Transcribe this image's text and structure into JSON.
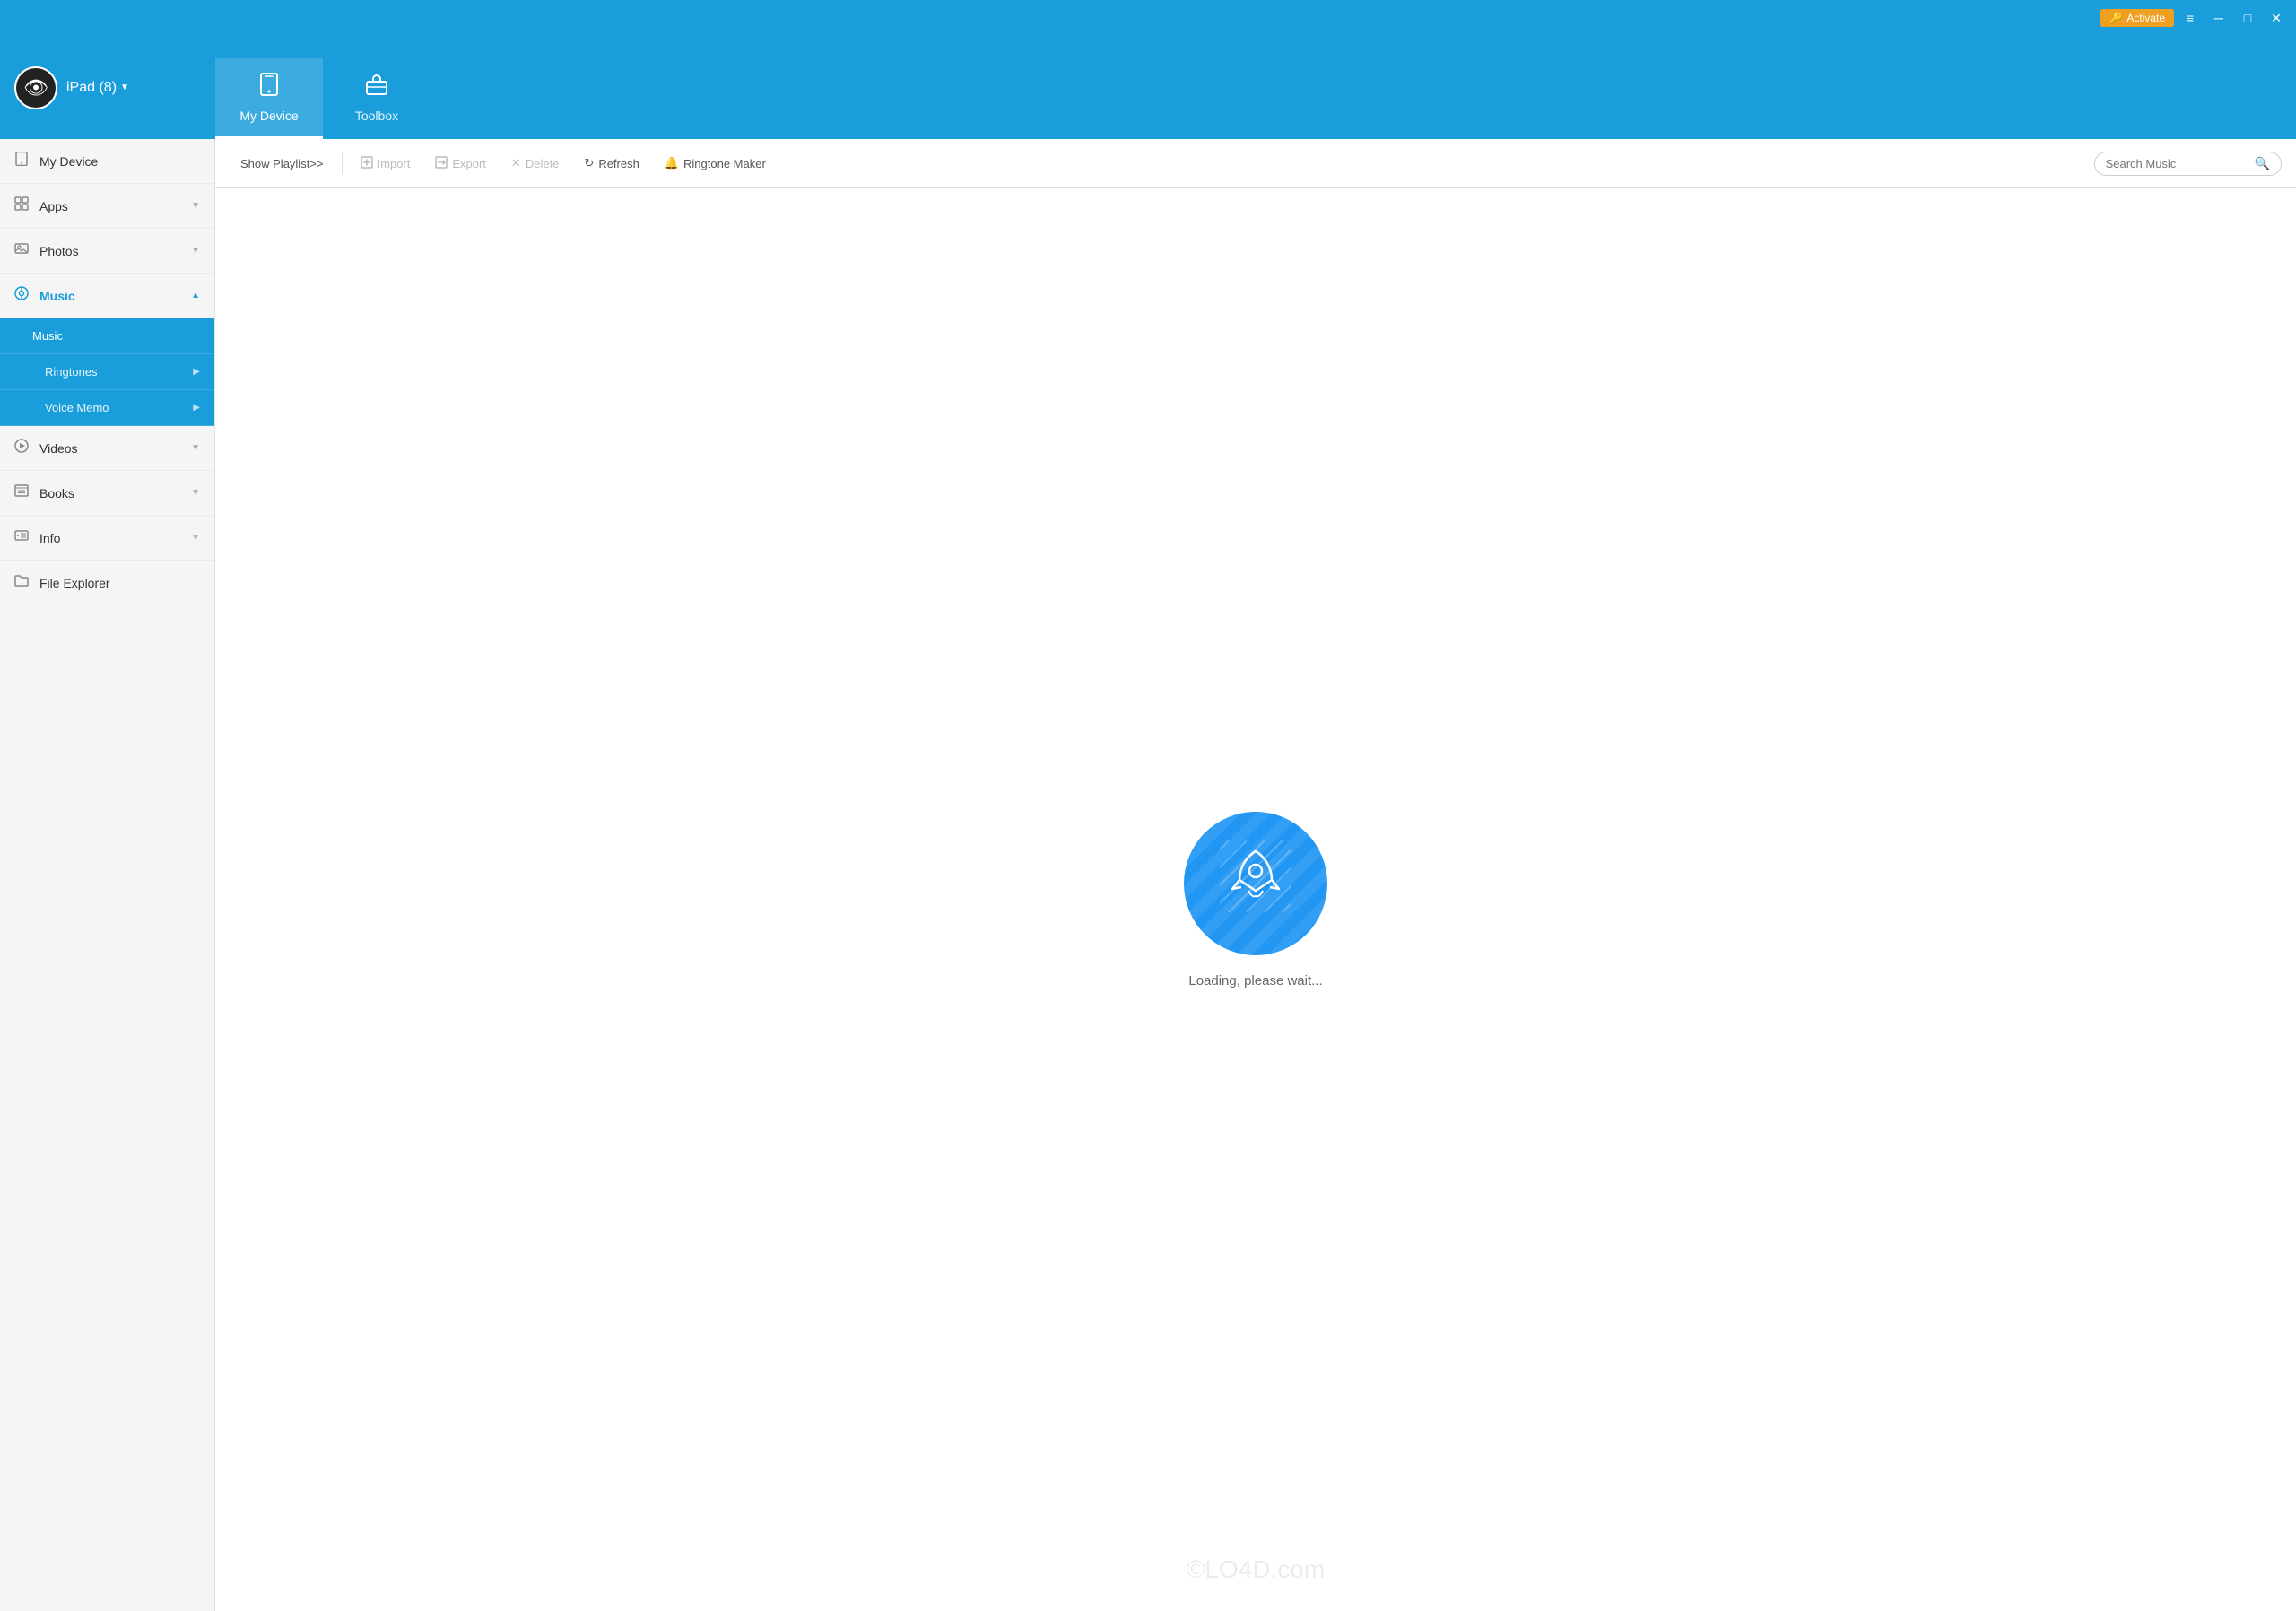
{
  "titlebar": {
    "activate_label": "Activate",
    "activate_icon": "🔑",
    "menu_icon": "≡",
    "minimize_icon": "─",
    "maximize_icon": "□",
    "close_icon": "✕"
  },
  "header": {
    "device_name": "iPad (8)",
    "tabs": [
      {
        "id": "my-device",
        "label": "My Device",
        "icon": "tablet",
        "active": true
      },
      {
        "id": "toolbox",
        "label": "Toolbox",
        "icon": "toolbox",
        "active": false
      }
    ]
  },
  "sidebar": {
    "items": [
      {
        "id": "my-device",
        "label": "My Device",
        "icon": "📱",
        "active": false,
        "expandable": false
      },
      {
        "id": "apps",
        "label": "Apps",
        "icon": "⊞",
        "active": false,
        "expandable": true
      },
      {
        "id": "photos",
        "label": "Photos",
        "icon": "🖼",
        "active": false,
        "expandable": true
      },
      {
        "id": "music",
        "label": "Music",
        "icon": "🔘",
        "active": true,
        "expandable": true
      }
    ],
    "music_sub": [
      {
        "id": "music-sub",
        "label": "Music",
        "active": true
      },
      {
        "id": "ringtones",
        "label": "Ringtones",
        "active": false
      },
      {
        "id": "voice-memo",
        "label": "Voice Memo",
        "active": false
      }
    ],
    "items2": [
      {
        "id": "videos",
        "label": "Videos",
        "icon": "▶",
        "active": false,
        "expandable": true
      },
      {
        "id": "books",
        "label": "Books",
        "icon": "📋",
        "active": false,
        "expandable": true
      },
      {
        "id": "info",
        "label": "Info",
        "icon": "💬",
        "active": false,
        "expandable": true
      },
      {
        "id": "file-explorer",
        "label": "File Explorer",
        "icon": "📁",
        "active": false,
        "expandable": false
      }
    ]
  },
  "toolbar": {
    "show_playlist": "Show Playlist>>",
    "import": "Import",
    "export": "Export",
    "delete": "Delete",
    "refresh": "Refresh",
    "ringtone_maker": "Ringtone Maker",
    "search_placeholder": "Search Music"
  },
  "content": {
    "loading_text": "Loading, please wait..."
  },
  "watermark": "©LO4D.com"
}
